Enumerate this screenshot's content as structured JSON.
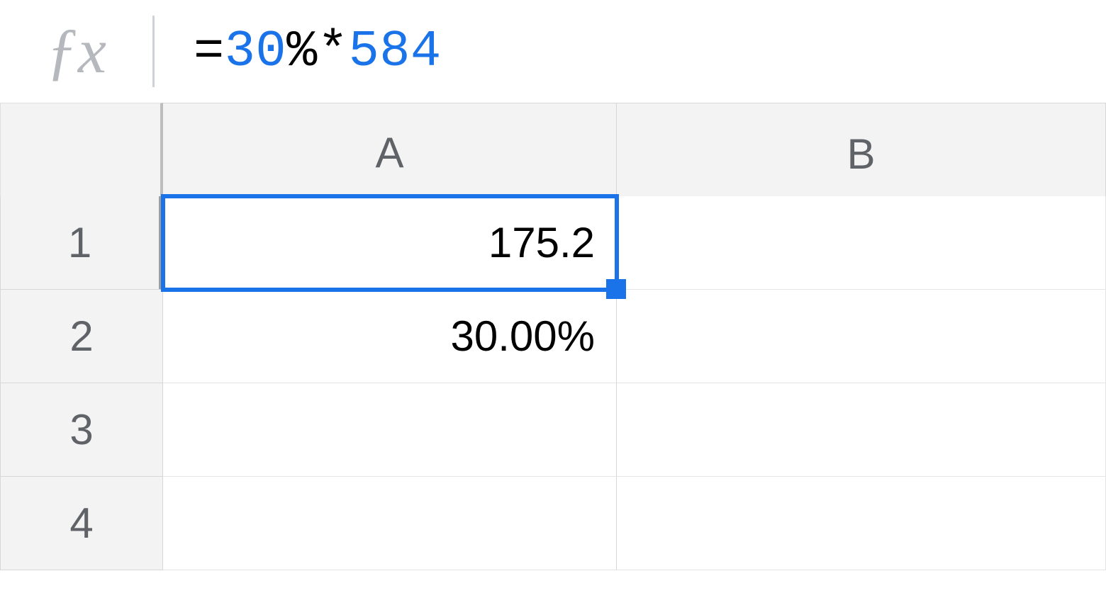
{
  "formula_bar": {
    "tokens": [
      {
        "text": "=",
        "class": "tok-black"
      },
      {
        "text": "30",
        "class": "tok-blue"
      },
      {
        "text": "%*",
        "class": "tok-black"
      },
      {
        "text": "584",
        "class": "tok-blue"
      }
    ]
  },
  "columns": [
    "A",
    "B"
  ],
  "rows": [
    "1",
    "2",
    "3",
    "4"
  ],
  "selected_col_index": 0,
  "selected_row_index": 0,
  "cells": {
    "A1": "175.2",
    "A2": "30.00%",
    "A3": "",
    "A4": "",
    "B1": "",
    "B2": "",
    "B3": "",
    "B4": ""
  },
  "selected_cell": "A1"
}
